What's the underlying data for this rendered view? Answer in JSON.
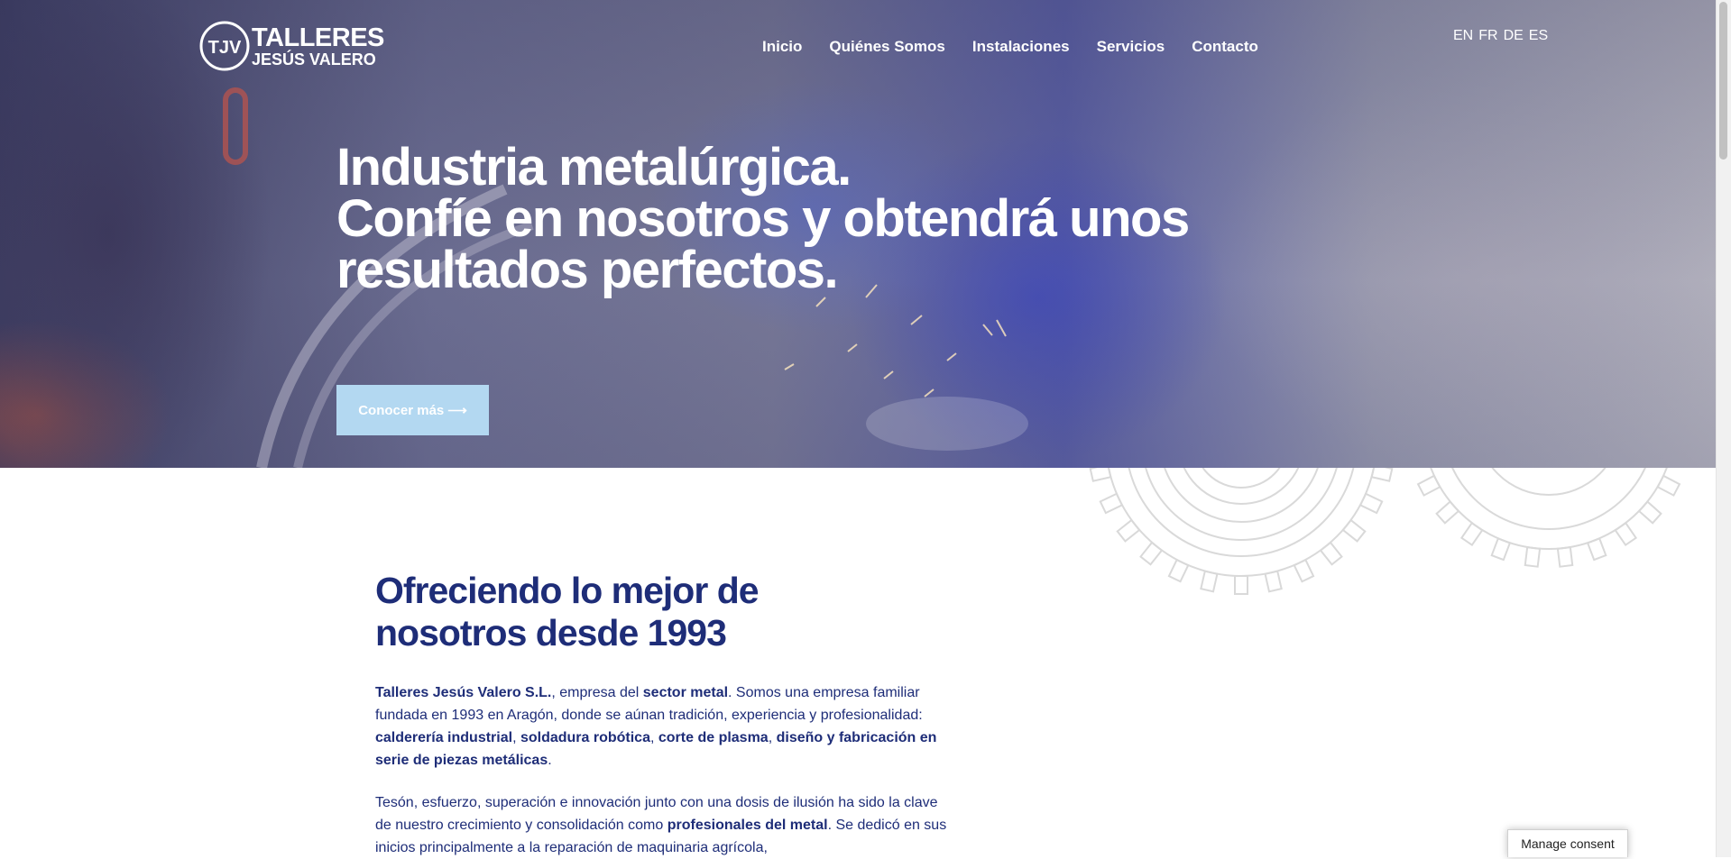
{
  "brand": {
    "logo_initials": "TJV",
    "line1": "TALLERES",
    "line2": "JESÚS VALERO"
  },
  "nav": {
    "items": [
      {
        "label": "Inicio"
      },
      {
        "label": "Quiénes Somos"
      },
      {
        "label": "Instalaciones"
      },
      {
        "label": "Servicios"
      },
      {
        "label": "Contacto"
      }
    ]
  },
  "languages": [
    "EN",
    "FR",
    "DE",
    "ES"
  ],
  "hero": {
    "title_lines": [
      "Industria metalúrgica.",
      "Confíe en nosotros y obtendrá unos",
      "resultados perfectos."
    ],
    "cta_label": "Conocer más",
    "cta_icon": "arrow-right-icon"
  },
  "about": {
    "title_lines": [
      "Ofreciendo lo mejor de",
      "nosotros desde 1993"
    ],
    "p1": [
      {
        "t": "Talleres Jesús Valero S.L.",
        "b": true
      },
      {
        "t": ", empresa del ",
        "b": false
      },
      {
        "t": "sector metal",
        "b": true
      },
      {
        "t": ". Somos una empresa familiar fundada en 1993 en Aragón, donde se aúnan tradición, experiencia y profesionalidad: ",
        "b": false
      },
      {
        "t": "calderería industrial",
        "b": true
      },
      {
        "t": ", ",
        "b": false
      },
      {
        "t": "soldadura robótica",
        "b": true
      },
      {
        "t": ", ",
        "b": false
      },
      {
        "t": "corte de plasma",
        "b": true
      },
      {
        "t": ", ",
        "b": false
      },
      {
        "t": "diseño y fabricación en serie de piezas metálicas",
        "b": true
      },
      {
        "t": ".",
        "b": false
      }
    ],
    "p2": [
      {
        "t": "Tesón, esfuerzo, superación e innovación junto con una dosis de ilusión ha sido la clave de nuestro crecimiento y consolidación como ",
        "b": false
      },
      {
        "t": "profesionales del metal",
        "b": true
      },
      {
        "t": ".  Se dedicó en sus inicios principalmente a la reparación de maquinaria agrícola,",
        "b": false
      }
    ]
  },
  "consent": {
    "label": "Manage consent"
  },
  "colors": {
    "primary": "#1e2d78",
    "cta_bg": "#b3d8f1",
    "white": "#ffffff"
  }
}
